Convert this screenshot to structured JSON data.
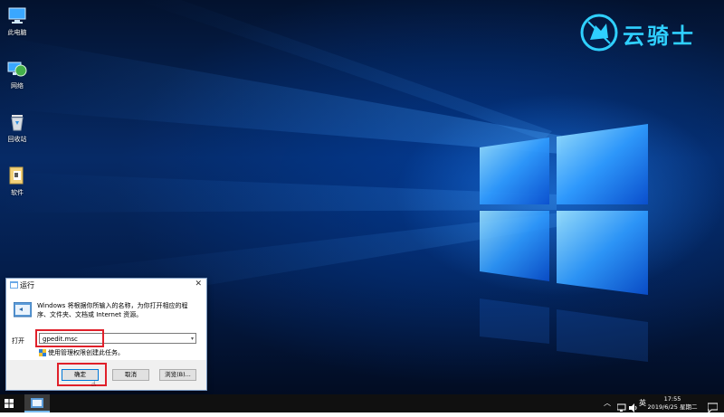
{
  "desktop": {
    "icons": [
      {
        "label": "此电脑",
        "icon": "computer-icon"
      },
      {
        "label": "网络",
        "icon": "network-icon"
      },
      {
        "label": "回收站",
        "icon": "recycle-bin-icon"
      },
      {
        "label": "软件",
        "icon": "folder-icon"
      }
    ],
    "logo_text": "云骑士"
  },
  "run_dialog": {
    "title": "运行",
    "close_glyph": "✕",
    "description": "Windows 将根据你所输入的名称，为你打开相应的程序、文件夹、文档或 Internet 资源。",
    "open_label": "打开",
    "open_value": "gpedit.msc",
    "admin_note": "使用管理权限创建此任务。",
    "buttons": {
      "ok": "确定",
      "cancel": "取消",
      "browse": "浏览(B)..."
    }
  },
  "taskbar": {
    "ime": "英",
    "time": "17:55",
    "date": "2019/6/25 星期二"
  },
  "colors": {
    "highlight": "#e0202a",
    "accent": "#0078d7",
    "logo": "#2fd0ff"
  }
}
